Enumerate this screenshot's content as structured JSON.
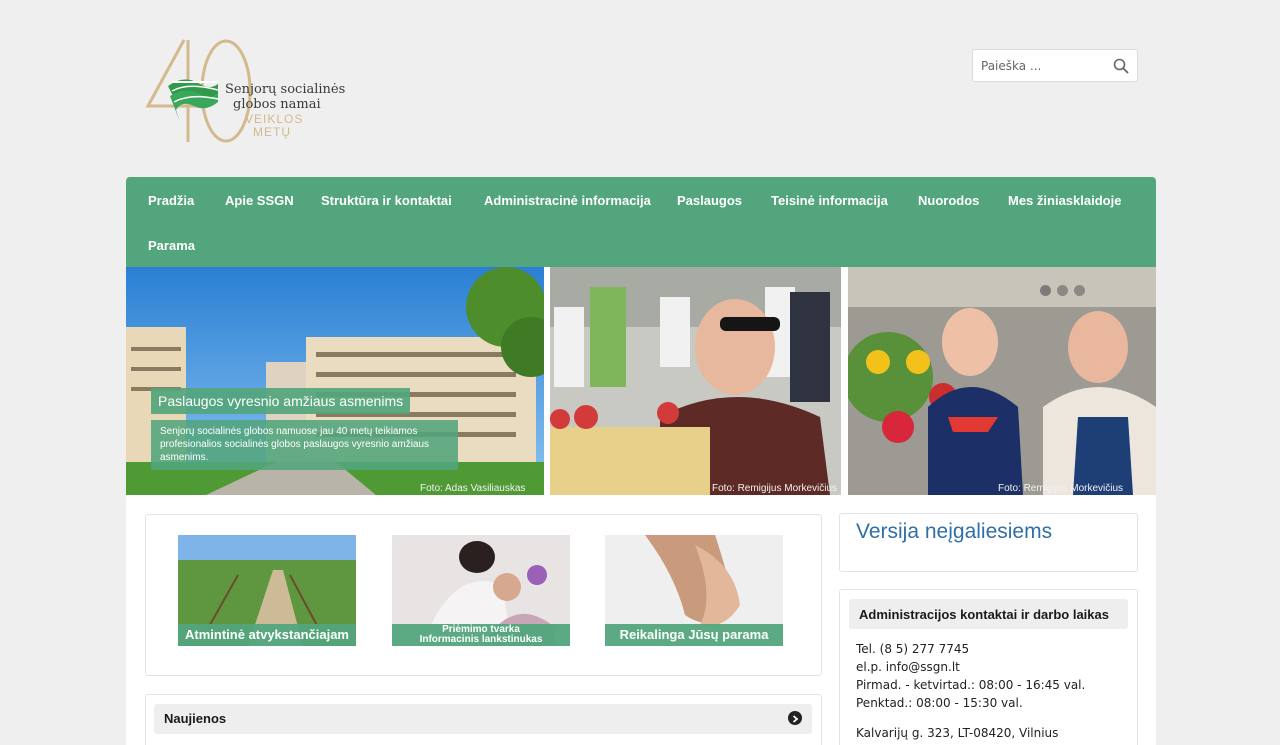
{
  "header": {
    "logo_number": "40",
    "logo_line1": "Senjorų socialinės",
    "logo_line2": "globos namai",
    "logo_sub1": "VEIKLOS",
    "logo_sub2": "METŲ"
  },
  "search": {
    "placeholder": "Paieška ..."
  },
  "nav": {
    "items": [
      "Pradžia",
      "Apie SSGN",
      "Struktūra ir kontaktai",
      "Administracinė informacija",
      "Paslaugos",
      "Teisinė informacija",
      "Nuorodos",
      "Mes žiniasklaidoje",
      "Parama"
    ]
  },
  "slider": {
    "caption_title": "Paslaugos vyresnio amžiaus asmenims",
    "caption_text": "Senjorų socialinės globos namuose jau 40 metų teikiamos profesionalios socialinės globos paslaugos vyresnio amžiaus asmenims.",
    "credits": [
      "Foto: Adas Vasiliauskas",
      "Foto: Remigijus Morkevičius",
      "Foto: Remigijus Morkevičius"
    ]
  },
  "banners": [
    {
      "label": "Atmintinė atvykstančiajam"
    },
    {
      "label_line1": "Priėmimo tvarka",
      "label_line2": "Informacinis lankstinukas"
    },
    {
      "label": "Reikalinga Jūsų parama"
    }
  ],
  "news": {
    "title": "Naujienos"
  },
  "sidebar": {
    "version_link": "Versija neįgaliesiems",
    "contact_title": "Administracijos kontaktai ir darbo laikas",
    "tel": "Tel. (8 5) 277 7745",
    "email": "el.p. info@ssgn.lt",
    "hours1": "Pirmad. - ketvirtad.: 08:00 - 16:45 val.",
    "hours2": "Penktad.: 08:00 - 15:30 val.",
    "address": "Kalvarijų g. 323, LT-08420, Vilnius"
  },
  "colors": {
    "accent": "#52a57c",
    "link": "#2f6fa8",
    "logo_gold": "#d3b98c"
  }
}
